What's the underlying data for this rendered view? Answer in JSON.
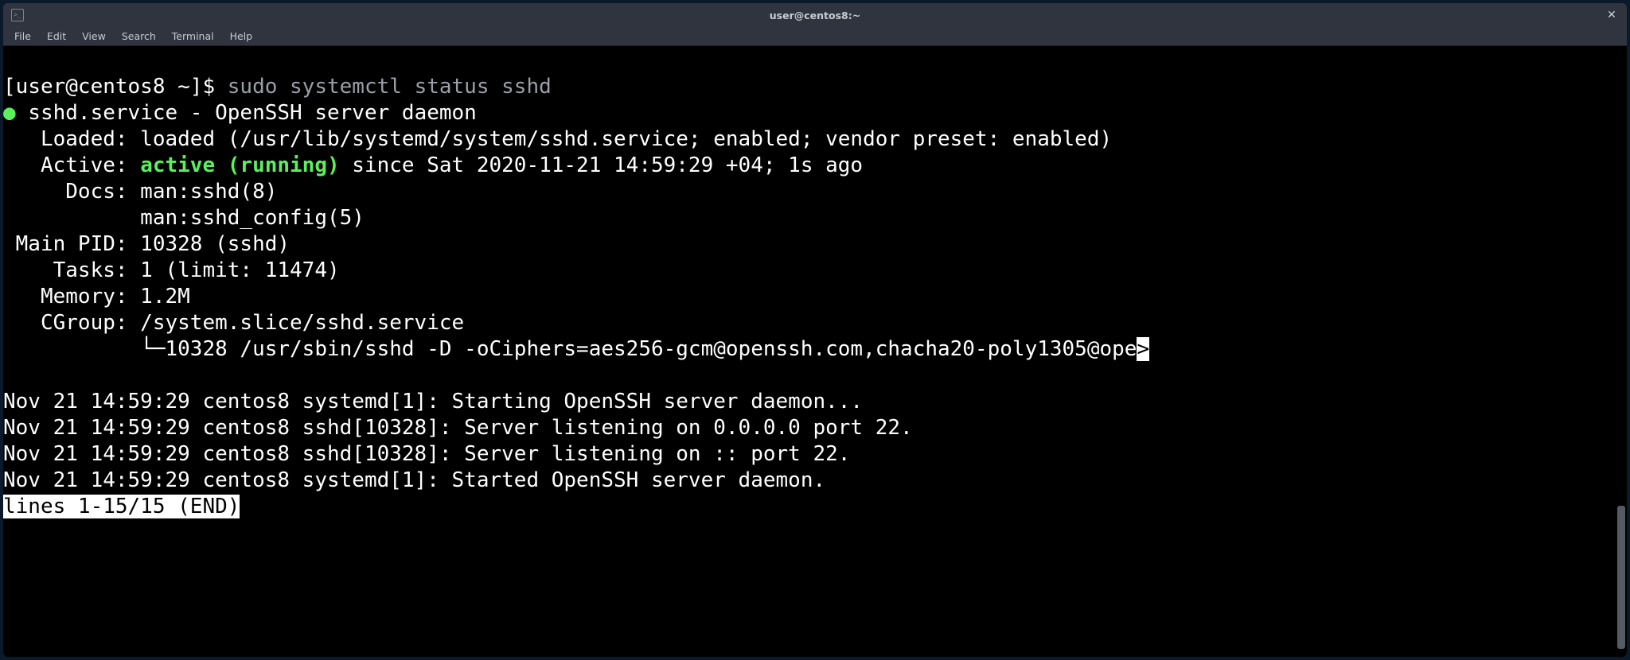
{
  "window": {
    "title": "user@centos8:~"
  },
  "menu": {
    "file": "File",
    "edit": "Edit",
    "view": "View",
    "search": "Search",
    "terminal": "Terminal",
    "help": "Help"
  },
  "prompt": "[user@centos8 ~]$ ",
  "command": "sudo systemctl status sshd",
  "svc": {
    "name_line": " sshd.service - OpenSSH server daemon",
    "loaded": "   Loaded: loaded (/usr/lib/systemd/system/sshd.service; enabled; vendor preset: enabled)",
    "active_lbl": "   Active: ",
    "active_running": "active (running)",
    "active_rest": " since Sat 2020-11-21 14:59:29 +04; 1s ago",
    "docs1": "     Docs: man:sshd(8)",
    "docs2": "           man:sshd_config(5)",
    "mainpid": " Main PID: 10328 (sshd)",
    "tasks": "    Tasks: 1 (limit: 11474)",
    "memory": "   Memory: 1.2M",
    "cgroup": "   CGroup: /system.slice/sshd.service",
    "cgroup2": "           └─10328 /usr/sbin/sshd -D -oCiphers=aes256-gcm@openssh.com,chacha20-poly1305@ope",
    "mark": ">"
  },
  "log": [
    "Nov 21 14:59:29 centos8 systemd[1]: Starting OpenSSH server daemon...",
    "Nov 21 14:59:29 centos8 sshd[10328]: Server listening on 0.0.0.0 port 22.",
    "Nov 21 14:59:29 centos8 sshd[10328]: Server listening on :: port 22.",
    "Nov 21 14:59:29 centos8 systemd[1]: Started OpenSSH server daemon."
  ],
  "pager_status": "lines 1-15/15 (END)"
}
